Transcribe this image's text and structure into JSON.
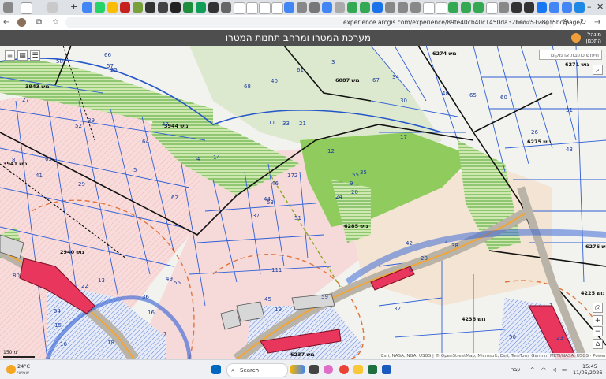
{
  "browser": {
    "tab_new_label": "+",
    "url": "experience.arcgis.com/experience/89fe40cb40c1450da32bed25128c15bc/page/",
    "url_suffix": "מערכת-המטרו",
    "tab_labels": [
      "ID",
      "ID",
      "ID",
      "ID",
      "G",
      "G",
      "G",
      "G",
      "G"
    ]
  },
  "app": {
    "title": "מערכת המטרו ומרחב תחנות המטרו",
    "logo_line1": "מינהל",
    "logo_line2": "התכנון"
  },
  "map": {
    "search_placeholder": "חיפוש כתובת או מקום",
    "scale_label": "150 מ'",
    "attribution": "Esri, NASA, NGA, USGS | © OpenStreetMap, Microsoft, Esri, TomTom, Garmin, METI/NASA, USGS · Powered by Esri",
    "zoom_in": "+",
    "zoom_out": "−",
    "home_label": "⌂",
    "block_labels": [
      "3943 גוש",
      "6087 גוש",
      "3944 גוש",
      "3941 גוש",
      "6274 גוש",
      "6271 גוש",
      "6275 גוש",
      "6285 גוש",
      "2940 גוש",
      "4225 גוש",
      "4236 גוש",
      "6276 גוש",
      "6237 גוש"
    ],
    "parcel_numbers": [
      "51",
      "52",
      "53",
      "54",
      "55",
      "56",
      "34",
      "21",
      "30",
      "24",
      "25",
      "23",
      "29",
      "31",
      "37",
      "17",
      "18",
      "11",
      "12",
      "13",
      "14",
      "15",
      "16",
      "33",
      "35",
      "38",
      "39",
      "40",
      "41",
      "42",
      "43",
      "44",
      "45",
      "46",
      "47",
      "48",
      "49",
      "50",
      "1",
      "2",
      "3",
      "4",
      "5",
      "6",
      "7",
      "8",
      "9",
      "10",
      "19",
      "20",
      "22",
      "26",
      "27",
      "28",
      "32",
      "36",
      "57",
      "58",
      "59",
      "60",
      "61",
      "62",
      "63",
      "64",
      "65",
      "66",
      "67",
      "68",
      "172",
      "80",
      "111"
    ]
  },
  "taskbar": {
    "weather_temp": "24°C",
    "weather_desc": "שמשי",
    "search_label": "Search",
    "lang": "עבר",
    "time": "15:45",
    "date": "11/05/2026"
  },
  "colors": {
    "parcel_line": "#2f5fd6",
    "green_zone": "#7bc043",
    "metro_zone": "#f7d7d3",
    "station": "#e8365d",
    "header": "#4e4e4e"
  }
}
